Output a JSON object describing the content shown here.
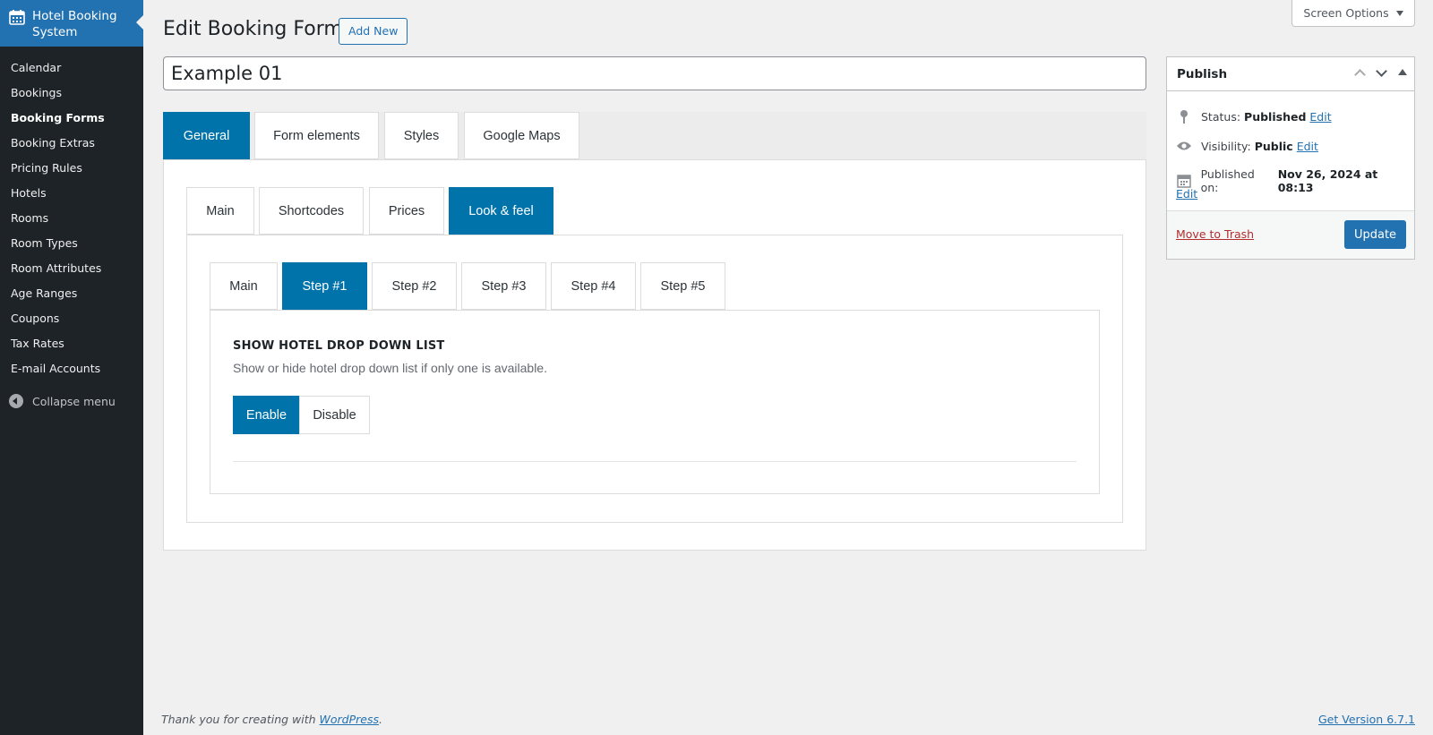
{
  "sidebar": {
    "brand": "Hotel Booking System",
    "items": [
      {
        "label": "Calendar"
      },
      {
        "label": "Bookings"
      },
      {
        "label": "Booking Forms"
      },
      {
        "label": "Booking Extras"
      },
      {
        "label": "Pricing Rules"
      },
      {
        "label": "Hotels"
      },
      {
        "label": "Rooms"
      },
      {
        "label": "Room Types"
      },
      {
        "label": "Room Attributes"
      },
      {
        "label": "Age Ranges"
      },
      {
        "label": "Coupons"
      },
      {
        "label": "Tax Rates"
      },
      {
        "label": "E-mail Accounts"
      }
    ],
    "active_index": 2,
    "collapse_label": "Collapse menu"
  },
  "header": {
    "screen_options": "Screen Options",
    "title": "Edit Booking Form",
    "add_new": "Add New"
  },
  "form": {
    "title_value": "Example 01",
    "tabs": [
      "General",
      "Form elements",
      "Styles",
      "Google Maps"
    ],
    "active_tab": "General",
    "subtabs": [
      "Main",
      "Shortcodes",
      "Prices",
      "Look & feel"
    ],
    "active_subtab": "Look & feel",
    "steptabs": [
      "Main",
      "Step #1",
      "Step #2",
      "Step #3",
      "Step #4",
      "Step #5"
    ],
    "active_steptab": "Step #1",
    "section_title": "SHOW HOTEL DROP DOWN LIST",
    "section_desc": "Show or hide hotel drop down list if only one is available.",
    "enable_label": "Enable",
    "disable_label": "Disable",
    "selected": "Enable"
  },
  "publish": {
    "title": "Publish",
    "status_label": "Status:",
    "status_value": "Published",
    "visibility_label": "Visibility:",
    "visibility_value": "Public",
    "published_label": "Published on:",
    "published_value": "Nov 26, 2024 at 08:13",
    "edit_label": "Edit",
    "trash_label": "Move to Trash",
    "update_label": "Update"
  },
  "footer": {
    "thanks_prefix": "Thank you for creating with",
    "wp_link": "WordPress",
    "thanks_suffix": ".",
    "version": "Get Version 6.7.1"
  },
  "colors": {
    "accent": "#0073aa",
    "wp_blue": "#2271b1",
    "sidebar_bg": "#1d2327",
    "trash_red": "#b32d2e"
  }
}
